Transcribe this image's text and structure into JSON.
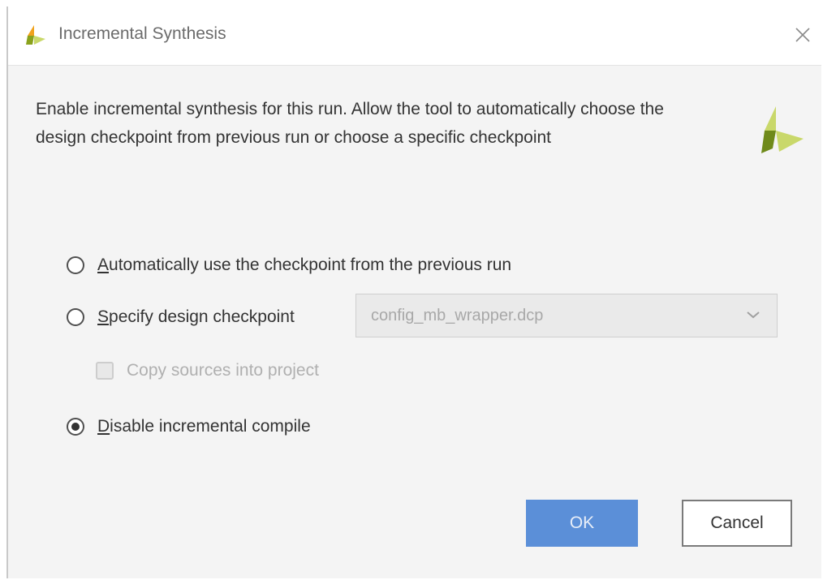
{
  "dialog": {
    "title": "Incremental Synthesis",
    "description": "Enable incremental synthesis for this run. Allow the tool to automatically choose the design checkpoint from previous run or choose a specific checkpoint"
  },
  "options": {
    "auto_label": "Automatically use the checkpoint from the previous run",
    "specify_label": "Specify design checkpoint",
    "specify_value": "config_mb_wrapper.dcp",
    "copy_sources_label": "Copy sources into project",
    "disable_label": "Disable incremental compile",
    "selected": "Disable incremental compile"
  },
  "buttons": {
    "ok": "OK",
    "cancel": "Cancel"
  },
  "icons": {
    "title": "vivado-logo-icon",
    "close": "close-icon",
    "dropdown": "chevron-down-icon",
    "header": "vivado-logo-icon"
  },
  "colors": {
    "ok_button": "#5b8fd8",
    "logo_dark": "#6f8a1a",
    "logo_light": "#c9d86a"
  }
}
